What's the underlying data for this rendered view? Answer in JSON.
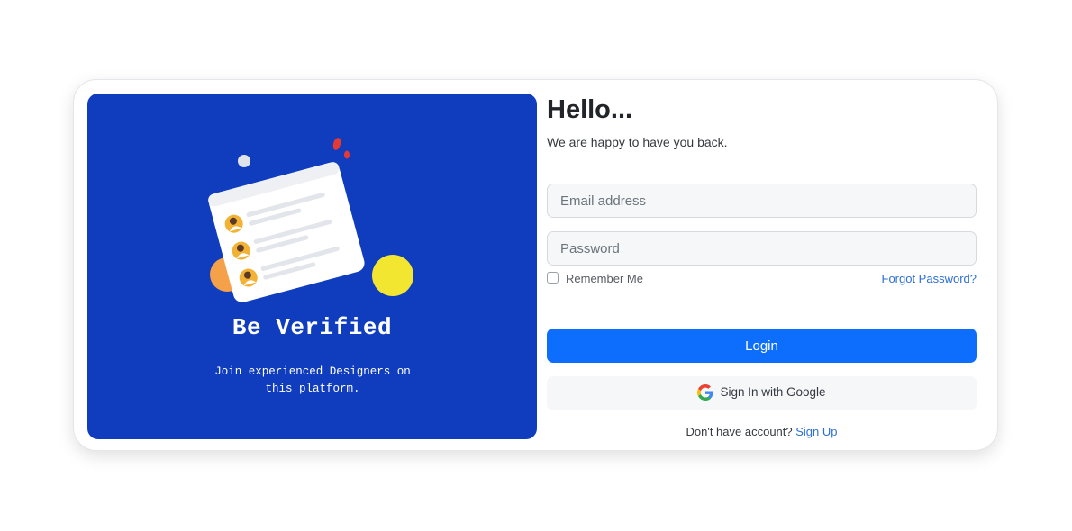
{
  "left": {
    "title": "Be Verified",
    "subtitle": "Join experienced Designers on this platform.",
    "colors": {
      "panel": "#103cbe",
      "accent_yellow": "#f2e630",
      "accent_orange": "#f5a14a",
      "accent_red": "#e53935"
    }
  },
  "login": {
    "heading": "Hello...",
    "tagline": "We are happy to have you back.",
    "email_placeholder": "Email address",
    "password_placeholder": "Password",
    "remember_label": "Remember Me",
    "forgot_label": "Forgot Password?",
    "login_label": "Login",
    "google_label": "Sign In with Google",
    "no_account_text": "Don't have account?",
    "signup_label": "Sign Up",
    "colors": {
      "primary": "#0d6efd",
      "link": "#2d6fd6"
    }
  }
}
